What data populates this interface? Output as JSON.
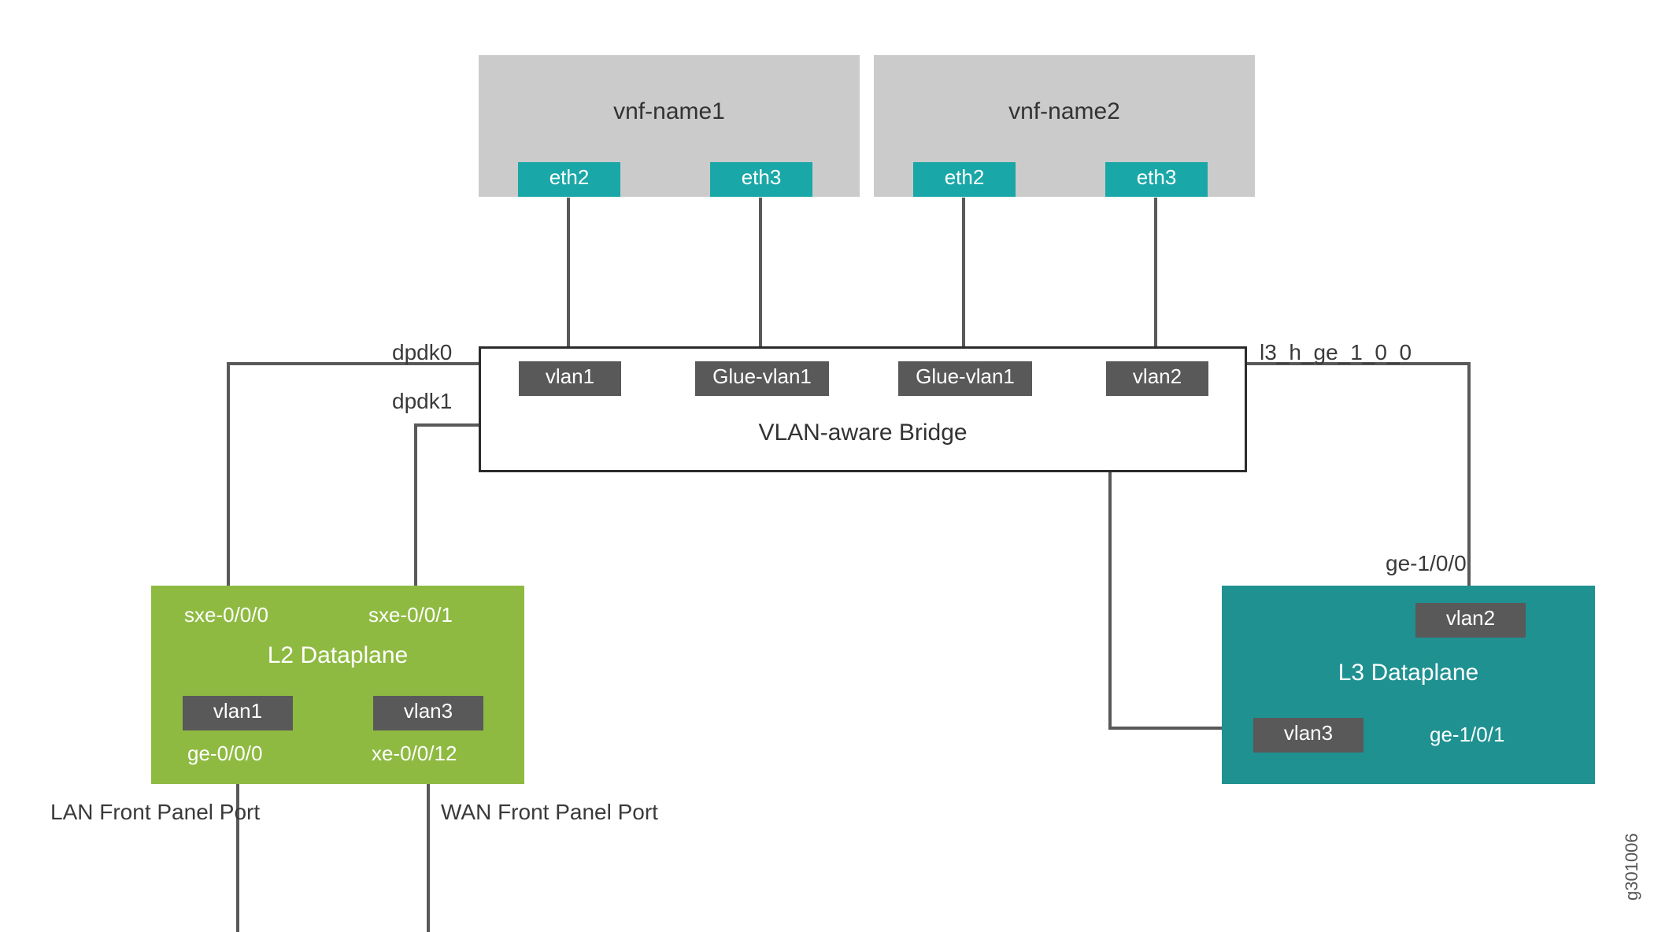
{
  "vnf1": {
    "title": "vnf-name1",
    "port_left": "eth2",
    "port_right": "eth3"
  },
  "vnf2": {
    "title": "vnf-name2",
    "port_left": "eth2",
    "port_right": "eth3"
  },
  "bridge": {
    "title": "VLAN-aware Bridge",
    "vlan_a": "vlan1",
    "glue_a": "Glue-vlan1",
    "glue_b": "Glue-vlan1",
    "vlan_b": "vlan2",
    "left_top_label": "dpdk0",
    "left_mid_label": "dpdk1",
    "right_top_label": "l3_h_ge_1_0_0"
  },
  "l2": {
    "title": "L2 Dataplane",
    "sxe0": "sxe-0/0/0",
    "sxe1": "sxe-0/0/1",
    "vlan1": "vlan1",
    "vlan3": "vlan3",
    "ge0": "ge-0/0/0",
    "xe12": "xe-0/0/12",
    "lan_caption": "LAN Front Panel Port",
    "wan_caption": "WAN Front Panel Port"
  },
  "l3": {
    "title": "L3 Dataplane",
    "ge0_label": "ge-1/0/0",
    "vlan2": "vlan2",
    "vlan3": "vlan3",
    "ge1": "ge-1/0/1"
  },
  "gid": "g301006"
}
